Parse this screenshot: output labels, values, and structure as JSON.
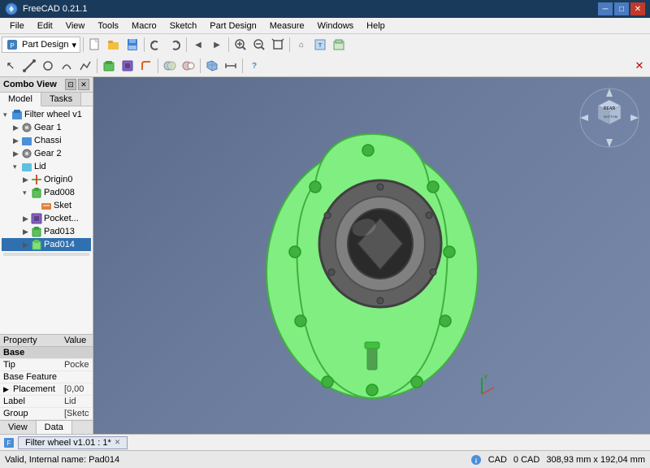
{
  "app": {
    "title": "FreeCAD 0.21.1",
    "icon": "freecad-icon"
  },
  "titlebar": {
    "title": "FreeCAD 0.21.1",
    "minimize_label": "─",
    "maximize_label": "□",
    "close_label": "✕"
  },
  "menubar": {
    "items": [
      "File",
      "Edit",
      "View",
      "Tools",
      "Macro",
      "Sketch",
      "Part Design",
      "Measure",
      "Windows",
      "Help"
    ]
  },
  "toolbar": {
    "workbench": "Part Design"
  },
  "left_panel": {
    "title": "Combo View",
    "tabs": [
      "Model",
      "Tasks"
    ],
    "active_tab": "Model",
    "tree": [
      {
        "id": "filter-wheel",
        "label": "Filter wheel v1",
        "level": 0,
        "expanded": true,
        "type": "part",
        "selected": false
      },
      {
        "id": "gear1",
        "label": "Gear 1",
        "level": 1,
        "expanded": false,
        "type": "gear",
        "selected": false
      },
      {
        "id": "chassi",
        "label": "Chassi",
        "level": 1,
        "expanded": false,
        "type": "part",
        "selected": false
      },
      {
        "id": "gear2",
        "label": "Gear 2",
        "level": 1,
        "expanded": false,
        "type": "gear",
        "selected": false
      },
      {
        "id": "lid",
        "label": "Lid",
        "level": 1,
        "expanded": true,
        "type": "body",
        "selected": false
      },
      {
        "id": "origin0",
        "label": "Origin0",
        "level": 2,
        "expanded": false,
        "type": "origin",
        "selected": false
      },
      {
        "id": "pad008",
        "label": "Pad008",
        "level": 2,
        "expanded": true,
        "type": "pad",
        "selected": false
      },
      {
        "id": "sket",
        "label": "Sket",
        "level": 3,
        "expanded": false,
        "type": "sketch",
        "selected": false
      },
      {
        "id": "pocket",
        "label": "Pocket...",
        "level": 2,
        "expanded": false,
        "type": "pocket",
        "selected": false
      },
      {
        "id": "pad013",
        "label": "Pad013",
        "level": 2,
        "expanded": false,
        "type": "pad",
        "selected": false
      },
      {
        "id": "pad014",
        "label": "Pad014",
        "level": 2,
        "expanded": false,
        "type": "pad",
        "selected": true
      }
    ]
  },
  "properties": {
    "headers": [
      "Property",
      "Value"
    ],
    "group": "Base",
    "rows": [
      {
        "property": "Tip",
        "value": "Pocke"
      },
      {
        "property": "Base Feature",
        "value": ""
      },
      {
        "property": "Placement",
        "value": "[0,00"
      },
      {
        "property": "Label",
        "value": "Lid"
      },
      {
        "property": "Group",
        "value": "[Sketc"
      }
    ]
  },
  "bottom_tabs": [
    "View",
    "Data"
  ],
  "active_bottom_tab": "Data",
  "viewport": {
    "bg_color1": "#5a6a8a",
    "bg_color2": "#7a8aaa"
  },
  "tab_bar": {
    "tabs": [
      {
        "label": "Filter wheel v1.01 : 1*",
        "closeable": true
      }
    ]
  },
  "statusbar": {
    "left_text": "Valid, Internal name: Pad014",
    "cad_label": "CAD",
    "coords": "308,93 mm x 192,04 mm",
    "units": "0 CAD"
  }
}
